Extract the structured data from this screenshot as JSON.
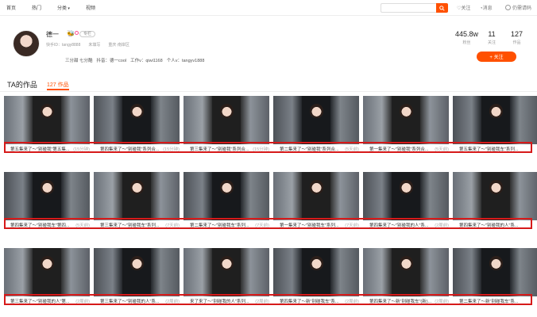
{
  "nav": {
    "home": "首页",
    "hot": "热门",
    "category": "分类",
    "video": "视频",
    "search_placeholder": "",
    "follow": "关注",
    "message": "消息",
    "login": "仍需请码"
  },
  "profile": {
    "name": "德一",
    "level_badge": "lv",
    "tag": "专栏",
    "meta": [
      "快手ID：tangy8888",
      "未填写",
      "重庆·南岸区"
    ],
    "bio": [
      "三分甜 七分酷",
      "抖音：德一cool",
      "工作v：qiwi1168",
      "个人v：tangyv1888"
    ],
    "stats": [
      {
        "num": "445.8w",
        "label": "粉丝"
      },
      {
        "num": "11",
        "label": "关注"
      },
      {
        "num": "127",
        "label": "作品"
      }
    ],
    "follow_button": "+ 关注"
  },
  "works": {
    "title": "TA的作品",
    "tab": "127 作品"
  },
  "rows": [
    {
      "cards": [
        {
          "title": "第五集来了～\"别碰我\"第五集...",
          "dur": "(15分钟)"
        },
        {
          "title": "第四集来了～\"别碰我\"系列合...",
          "dur": "(15分钟)"
        },
        {
          "title": "第三集来了～\"别碰我\"系列合...",
          "dur": "(15分钟)"
        },
        {
          "title": "第二集来了～\"别碰我\"系列合...",
          "dur": "(5天前)"
        },
        {
          "title": "第一集来了～\"别碰我\"系列合...",
          "dur": "(5天前)"
        },
        {
          "title": "第五集来了～\"别碰我车\"系列...",
          "dur": ""
        }
      ]
    },
    {
      "cards": [
        {
          "title": "第四集来了～\"别碰我车\"第四...",
          "dur": "(5天前)"
        },
        {
          "title": "第三集来了～\"别碰我车\"系列...",
          "dur": "(7天前)"
        },
        {
          "title": "第二集来了～\"别碰我车\"系列...",
          "dur": "(7天前)"
        },
        {
          "title": "第一集来了～\"别碰我车\"系列...",
          "dur": "(7天前)"
        },
        {
          "title": "第四集来了～\"别碰我的人\"系...",
          "dur": "(2周前)"
        },
        {
          "title": "第四集来了～\"别碰我的人\"系...",
          "dur": ""
        }
      ]
    },
    {
      "cards": [
        {
          "title": "第三集来了～\"别碰我的人\"第...",
          "dur": "(2周前)"
        },
        {
          "title": "第三集来了～\"别碰我的人\"系...",
          "dur": "(2周前)"
        },
        {
          "title": "来了来了～\"别碰我的人\"系列...",
          "dur": "(2周前)"
        },
        {
          "title": "第四集来了～新\"别碰我车\"系...",
          "dur": "(2周前)"
        },
        {
          "title": "第四集来了～新\"别碰我车\"(新)...",
          "dur": "(2周前)"
        },
        {
          "title": "第二集来了～新\"别碰我车\"系...",
          "dur": ""
        }
      ]
    }
  ],
  "colors": {
    "accent": "#ff5000",
    "highlight": "#d61a1a"
  }
}
